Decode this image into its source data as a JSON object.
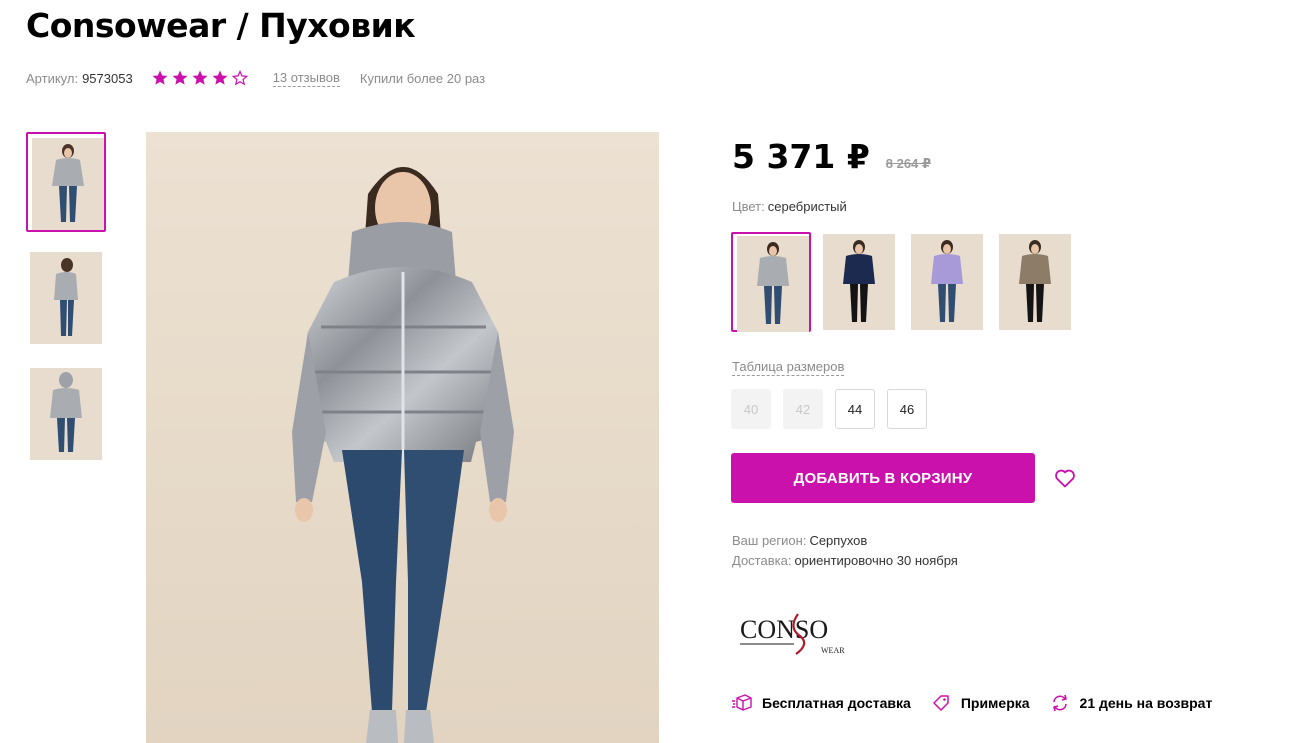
{
  "product": {
    "title": "Consowear / Пуховик",
    "sku_label": "Артикул:",
    "sku": "9573053",
    "rating": 4,
    "rating_max": 5,
    "reviews": "13 отзывов",
    "bought": "Купили более 20 раз"
  },
  "thumbnails": [
    {
      "view": "front",
      "selected": true
    },
    {
      "view": "side",
      "selected": false
    },
    {
      "view": "back",
      "selected": false
    }
  ],
  "price": {
    "current": "5 371 ₽",
    "old": "8 264 ₽"
  },
  "color": {
    "label": "Цвет:",
    "value": "серебристый",
    "swatches": [
      {
        "name": "silver",
        "jacket": "#a9adb2",
        "pants": "#2f4e72",
        "selected": true
      },
      {
        "name": "navy",
        "jacket": "#1c2a4f",
        "pants": "#141414",
        "selected": false
      },
      {
        "name": "lilac",
        "jacket": "#a89ad8",
        "pants": "#2f4e72",
        "selected": false
      },
      {
        "name": "bronze",
        "jacket": "#8d7c68",
        "pants": "#141414",
        "selected": false
      }
    ]
  },
  "sizes": {
    "table_link": "Таблица размеров",
    "items": [
      {
        "label": "40",
        "available": false
      },
      {
        "label": "42",
        "available": false
      },
      {
        "label": "44",
        "available": true
      },
      {
        "label": "46",
        "available": true
      }
    ]
  },
  "cart": {
    "button": "ДОБАВИТЬ В КОРЗИНУ"
  },
  "delivery": {
    "region_label": "Ваш регион:",
    "region": "Серпухов",
    "delivery_label": "Доставка:",
    "delivery_value": "ориентировочно 30 ноября"
  },
  "brand": {
    "logo_text": "CONSO",
    "logo_sub": "WEAR"
  },
  "features": [
    {
      "icon": "box-icon",
      "label": "Бесплатная доставка"
    },
    {
      "icon": "tag-icon",
      "label": "Примерка"
    },
    {
      "icon": "return-icon",
      "label": "21 день на возврат"
    }
  ],
  "colors": {
    "accent": "#cb11ab",
    "muted_text": "#8b8b8b"
  }
}
